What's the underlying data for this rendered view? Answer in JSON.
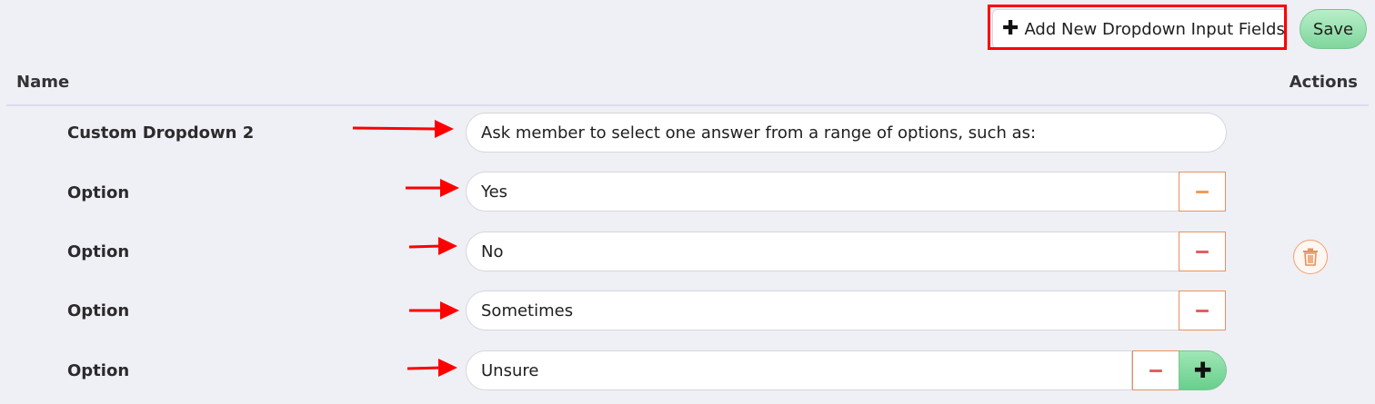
{
  "toolbar": {
    "add_label": "Add New Dropdown Input Fields",
    "save_label": "Save"
  },
  "table": {
    "col_name": "Name",
    "col_actions": "Actions"
  },
  "dropdown": {
    "name": "Custom Dropdown 2",
    "question": "Ask member to select one answer from a range of options, such as:",
    "option_label": "Option",
    "options": [
      "Yes",
      "No",
      "Sometimes",
      "Unsure"
    ]
  },
  "colors": {
    "highlight": "#ff0000",
    "save_green": "#7fd69c",
    "remove_red": "#e06060",
    "trash_orange": "#e8915c"
  },
  "icons": {
    "add": "plus-icon",
    "remove": "minus-icon",
    "delete": "trash-icon",
    "annotation": "red-arrow-icon"
  }
}
